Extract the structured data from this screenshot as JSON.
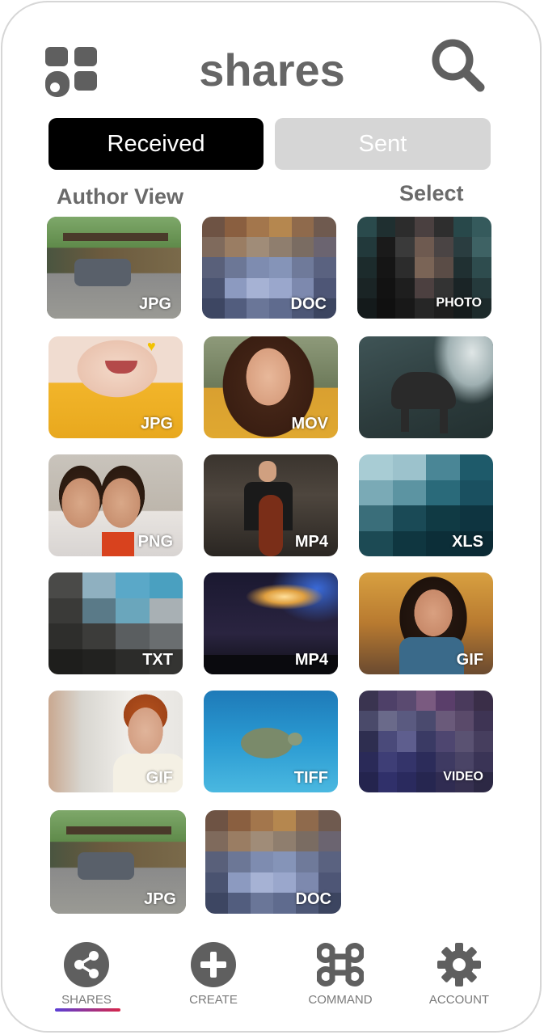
{
  "header": {
    "title": "shares"
  },
  "tabs": {
    "received": "Received",
    "sent": "Sent"
  },
  "toolbar": {
    "view_label": "Author View",
    "select_label": "Select"
  },
  "files": [
    {
      "type": "JPG"
    },
    {
      "type": "DOC"
    },
    {
      "type": "PHOTO"
    },
    {
      "type": "JPG"
    },
    {
      "type": "MOV"
    },
    {
      "type": ""
    },
    {
      "type": "PNG"
    },
    {
      "type": "MP4"
    },
    {
      "type": "XLS"
    },
    {
      "type": "TXT"
    },
    {
      "type": "MP4"
    },
    {
      "type": "GIF"
    },
    {
      "type": "GIF"
    },
    {
      "type": "TIFF"
    },
    {
      "type": "VIDEO"
    },
    {
      "type": "JPG"
    },
    {
      "type": "DOC"
    }
  ],
  "nav": {
    "shares": "SHARES",
    "create": "CREATE",
    "command": "COMMAND",
    "account": "ACCOUNT"
  },
  "colors": {
    "active_tab": "#000000",
    "inactive_tab": "#d6d6d6",
    "icon_gray": "#5f5f5f",
    "underline_start": "#5b3fd6",
    "underline_end": "#d6264a"
  }
}
